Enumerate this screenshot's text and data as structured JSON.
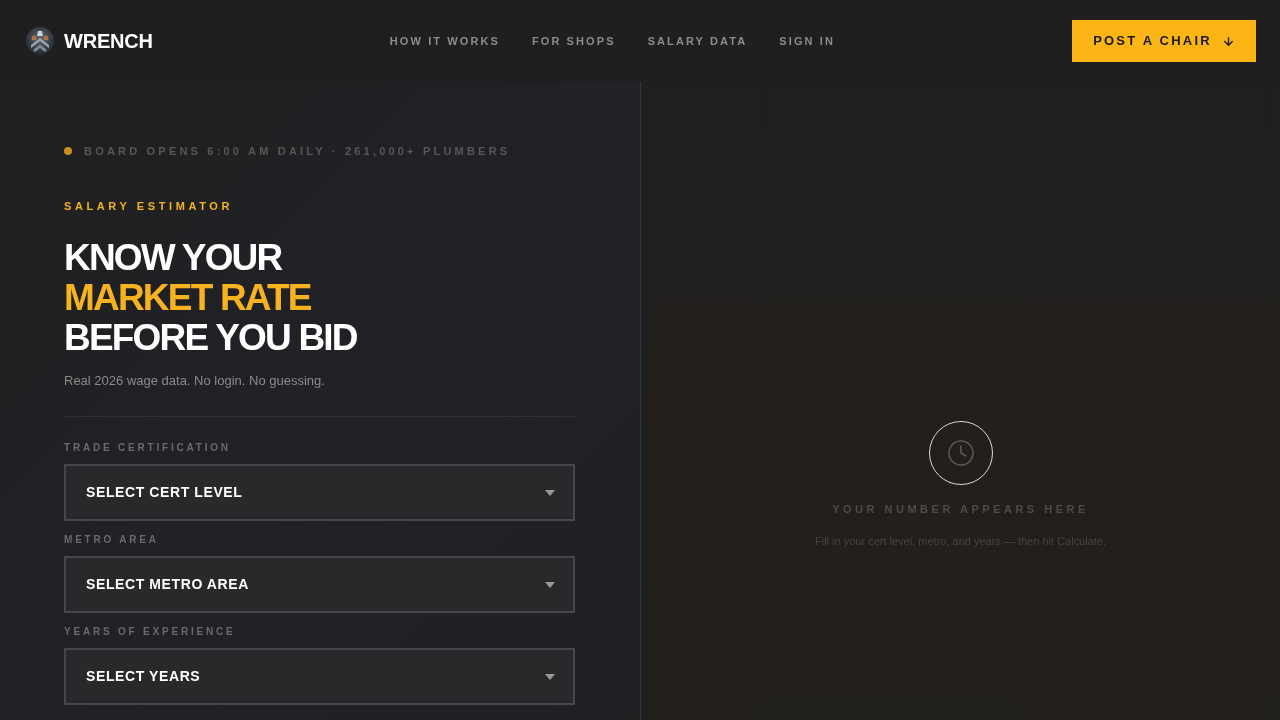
{
  "header": {
    "brand": "WRENCH",
    "nav": [
      {
        "label": "HOW IT WORKS"
      },
      {
        "label": "FOR SHOPS"
      },
      {
        "label": "SALARY DATA"
      },
      {
        "label": "SIGN IN"
      }
    ],
    "cta": "POST A CHAIR"
  },
  "hero": {
    "status": "BOARD OPENS 6:00 AM DAILY · 261,000+ PLUMBERS",
    "eyebrow": "SALARY ESTIMATOR",
    "headline": [
      {
        "text": "KNOW YOUR",
        "highlight": false
      },
      {
        "text": "MARKET RATE",
        "highlight": true
      },
      {
        "text": "BEFORE YOU BID",
        "highlight": false
      }
    ],
    "subtitle": "Real 2026 wage data. No login. No guessing."
  },
  "form": {
    "fields": [
      {
        "label": "TRADE CERTIFICATION",
        "placeholder": "SELECT CERT LEVEL"
      },
      {
        "label": "METRO AREA",
        "placeholder": "SELECT METRO AREA"
      },
      {
        "label": "YEARS OF EXPERIENCE",
        "placeholder": "SELECT YEARS"
      }
    ]
  },
  "result": {
    "title": "YOUR NUMBER APPEARS HERE",
    "hint": "Fill in your cert level, metro, and years — then hit Calculate."
  }
}
